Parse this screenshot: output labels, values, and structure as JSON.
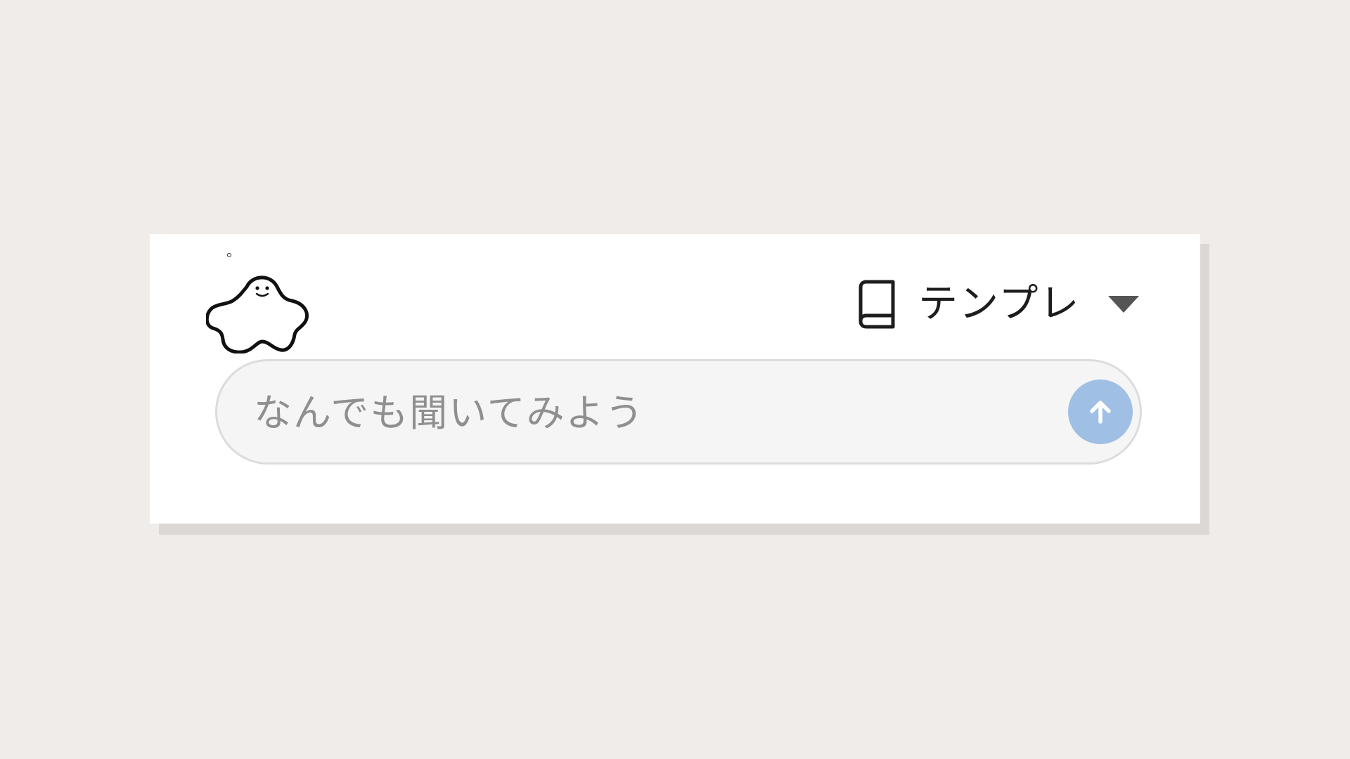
{
  "template_dropdown": {
    "label": "テンプレ",
    "icon": "book-icon",
    "chevron": "chevron-down-icon"
  },
  "search": {
    "placeholder": "なんでも聞いてみよう",
    "value": ""
  },
  "send_button": {
    "icon": "arrow-up-icon",
    "color": "#9fbfe4"
  },
  "mascot": {
    "icon": "blob-mascot-icon"
  },
  "colors": {
    "page_background": "#f0ece9",
    "card_background": "#ffffff",
    "input_background": "#f5f5f5",
    "accent": "#9fbfe4"
  }
}
